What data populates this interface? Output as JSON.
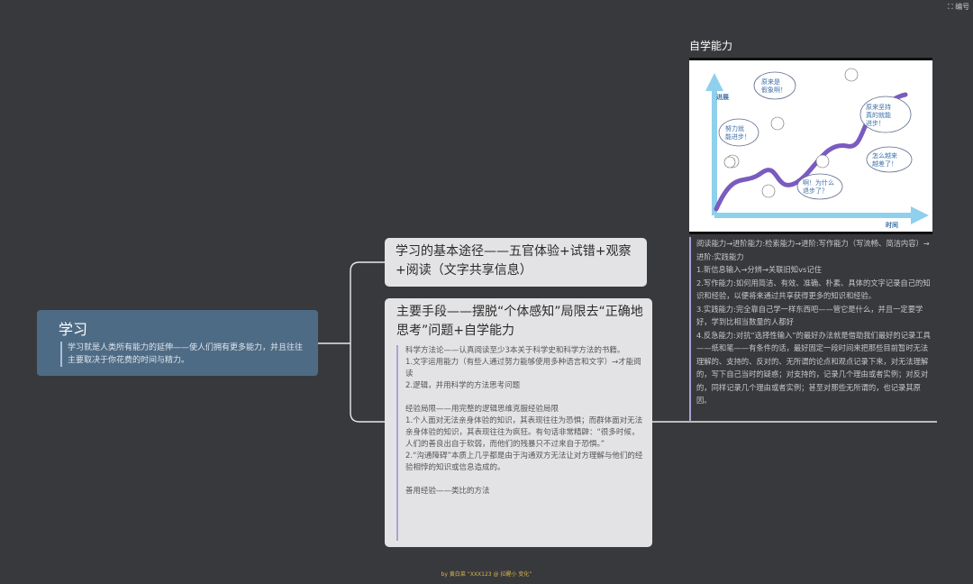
{
  "toolbar": {
    "icon": "expand-icon",
    "label": "编号"
  },
  "root": {
    "title": "学习",
    "note": "学习就是人类所有能力的延伸——使人们拥有更多能力，并且往往主要取决于你花费的时间与精力。"
  },
  "branch1": {
    "title": "学习的基本途径——五官体验+试错+观察+阅读（文字共享信息）"
  },
  "branch2": {
    "title": "主要手段——摆脱“个体感知”局限去“正确地思考”问题+自学能力",
    "note": [
      "科学方法论——认真阅读至少3本关于科学史和科学方法的书籍。",
      "1.文字运用能力（有些人通过努力能够使用多种语言和文字）→才能阅读",
      "2.逻辑，并用科学的方法思考问题",
      "",
      "经验局限——用完整的逻辑思维克服经验局限",
      "1.个人面对无法亲身体验的知识，其表现往往为恐惧；而群体面对无法亲身体验的知识，其表现往往为疯狂。有句话非常精辟：“很多时候，人们的善良出自于软弱，而他们的残暴只不过来自于恐惧。”",
      "2.“沟通障碍”本质上几乎都是由于沟通双方无法让对方理解与他们的经验相悖的知识或信息造成的。",
      "",
      "善用经验——类比的方法"
    ]
  },
  "branch3": {
    "title": "自学能力",
    "image": {
      "y_axis": "进展",
      "x_axis": "时间",
      "bubbles": [
        "努力就能进步！",
        "原来是假象啊！",
        "原来坚持真的就能进步！",
        "怎么越来越差了！",
        "啊！为什么退步了？"
      ]
    },
    "note": [
      "阅读能力→进阶能力:检索能力→进阶:写作能力（写流畅、简洁内容）→进阶:实践能力",
      "1.新信息输入→分辨→关联旧知vs记住",
      "2.写作能力:如何用简洁、有效、准确、朴素、具体的文字记录自己的知识和经验，以便将来通过共享获得更多的知识和经验。",
      "3.实践能力:完全靠自己学一样东西吧——管它是什么，并且一定要学好，学到比相当数量的人都好",
      "4.反急能力:对抗“选择性输入”的最好办法就是借助我们最好的记录工具——纸和笔——有条件的话，最好固定一段时间来把那些目前暂时无法理解的、支持的、反对的、无所谓的论点和观点记录下来，对无法理解的，写下自己当时的疑惑；对支持的，记录几个理由或者实例；对反对的，同样记录几个理由或者实例；甚至对那些无所谓的，也记录其原因。"
    ]
  },
  "footer": "by 黄白菜 “XXX123 @ 拉醒小 变化”",
  "colors": {
    "background": "#38393d",
    "root": "#4e6b85",
    "card": "#e3e3e5",
    "connector": "#e8e8e8",
    "accent": "#a8a3d6"
  }
}
